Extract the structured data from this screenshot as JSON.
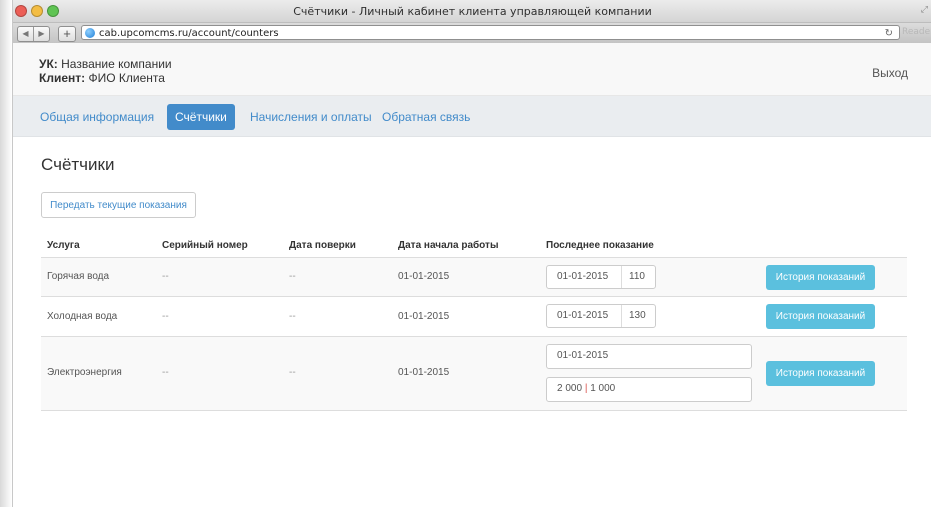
{
  "window": {
    "title": "Счётчики - Личный кабинет клиента управляющей компании",
    "url": "cab.upcomcms.ru/account/counters",
    "reader_label": "Reader"
  },
  "header": {
    "company_label": "УК:",
    "company_name": "Название компании",
    "client_label": "Клиент:",
    "client_name": "ФИО Клиента",
    "logout_label": "Выход"
  },
  "nav": {
    "items": [
      {
        "label": "Общая информация"
      },
      {
        "label": "Счётчики"
      },
      {
        "label": "Начисления и оплаты"
      },
      {
        "label": "Обратная связь"
      }
    ],
    "active_index": 1
  },
  "page": {
    "title": "Счётчики",
    "submit_button": "Передать текущие показания"
  },
  "table": {
    "headers": [
      "Услуга",
      "Серийный номер",
      "Дата поверки",
      "Дата начала работы",
      "Последнее показание"
    ],
    "rows": [
      {
        "service": "Горячая вода",
        "serial": "--",
        "check_date": "--",
        "start_date": "01-01-2015",
        "reading_date": "01-01-2015",
        "reading_value": "110",
        "history_label": "История показаний"
      },
      {
        "service": "Холодная вода",
        "serial": "--",
        "check_date": "--",
        "start_date": "01-01-2015",
        "reading_date": "01-01-2015",
        "reading_value": "130",
        "history_label": "История показаний"
      },
      {
        "service": "Электроэнергия",
        "serial": "--",
        "check_date": "--",
        "start_date": "01-01-2015",
        "reading_date": "01-01-2015",
        "reading_value_day": "2 000",
        "reading_separator": "|",
        "reading_value_night": "1 000",
        "history_label": "История показаний"
      }
    ]
  },
  "colors": {
    "accent": "#428bca",
    "history_button": "#5bc0de",
    "nav_background": "#eaedf0"
  }
}
